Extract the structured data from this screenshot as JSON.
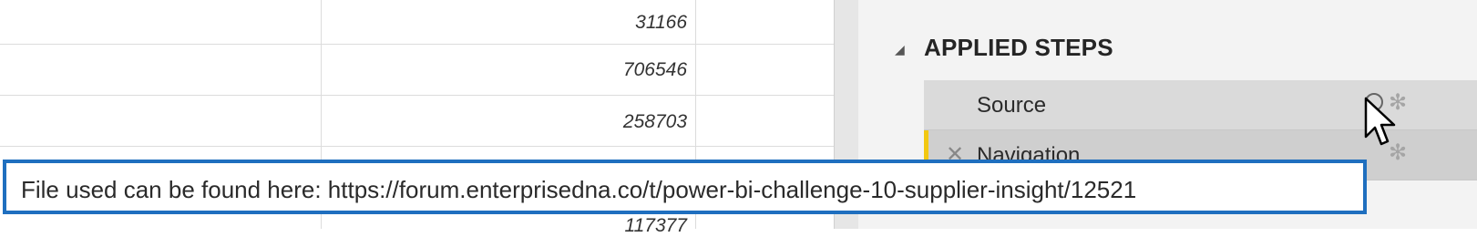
{
  "grid": {
    "visible_values": [
      "31166",
      "706546",
      "258703"
    ],
    "partial_value": "117377"
  },
  "query_settings": {
    "section_title": "APPLIED STEPS",
    "steps": [
      {
        "label": "Source"
      },
      {
        "label": "Navigation"
      }
    ]
  },
  "caption": {
    "text": "File used can be found here: https://forum.enterprisedna.co/t/power-bi-challenge-10-supplier-insight/12521"
  },
  "colors": {
    "caption_border": "#1f6fbf",
    "step_highlight": "#f2c811"
  }
}
